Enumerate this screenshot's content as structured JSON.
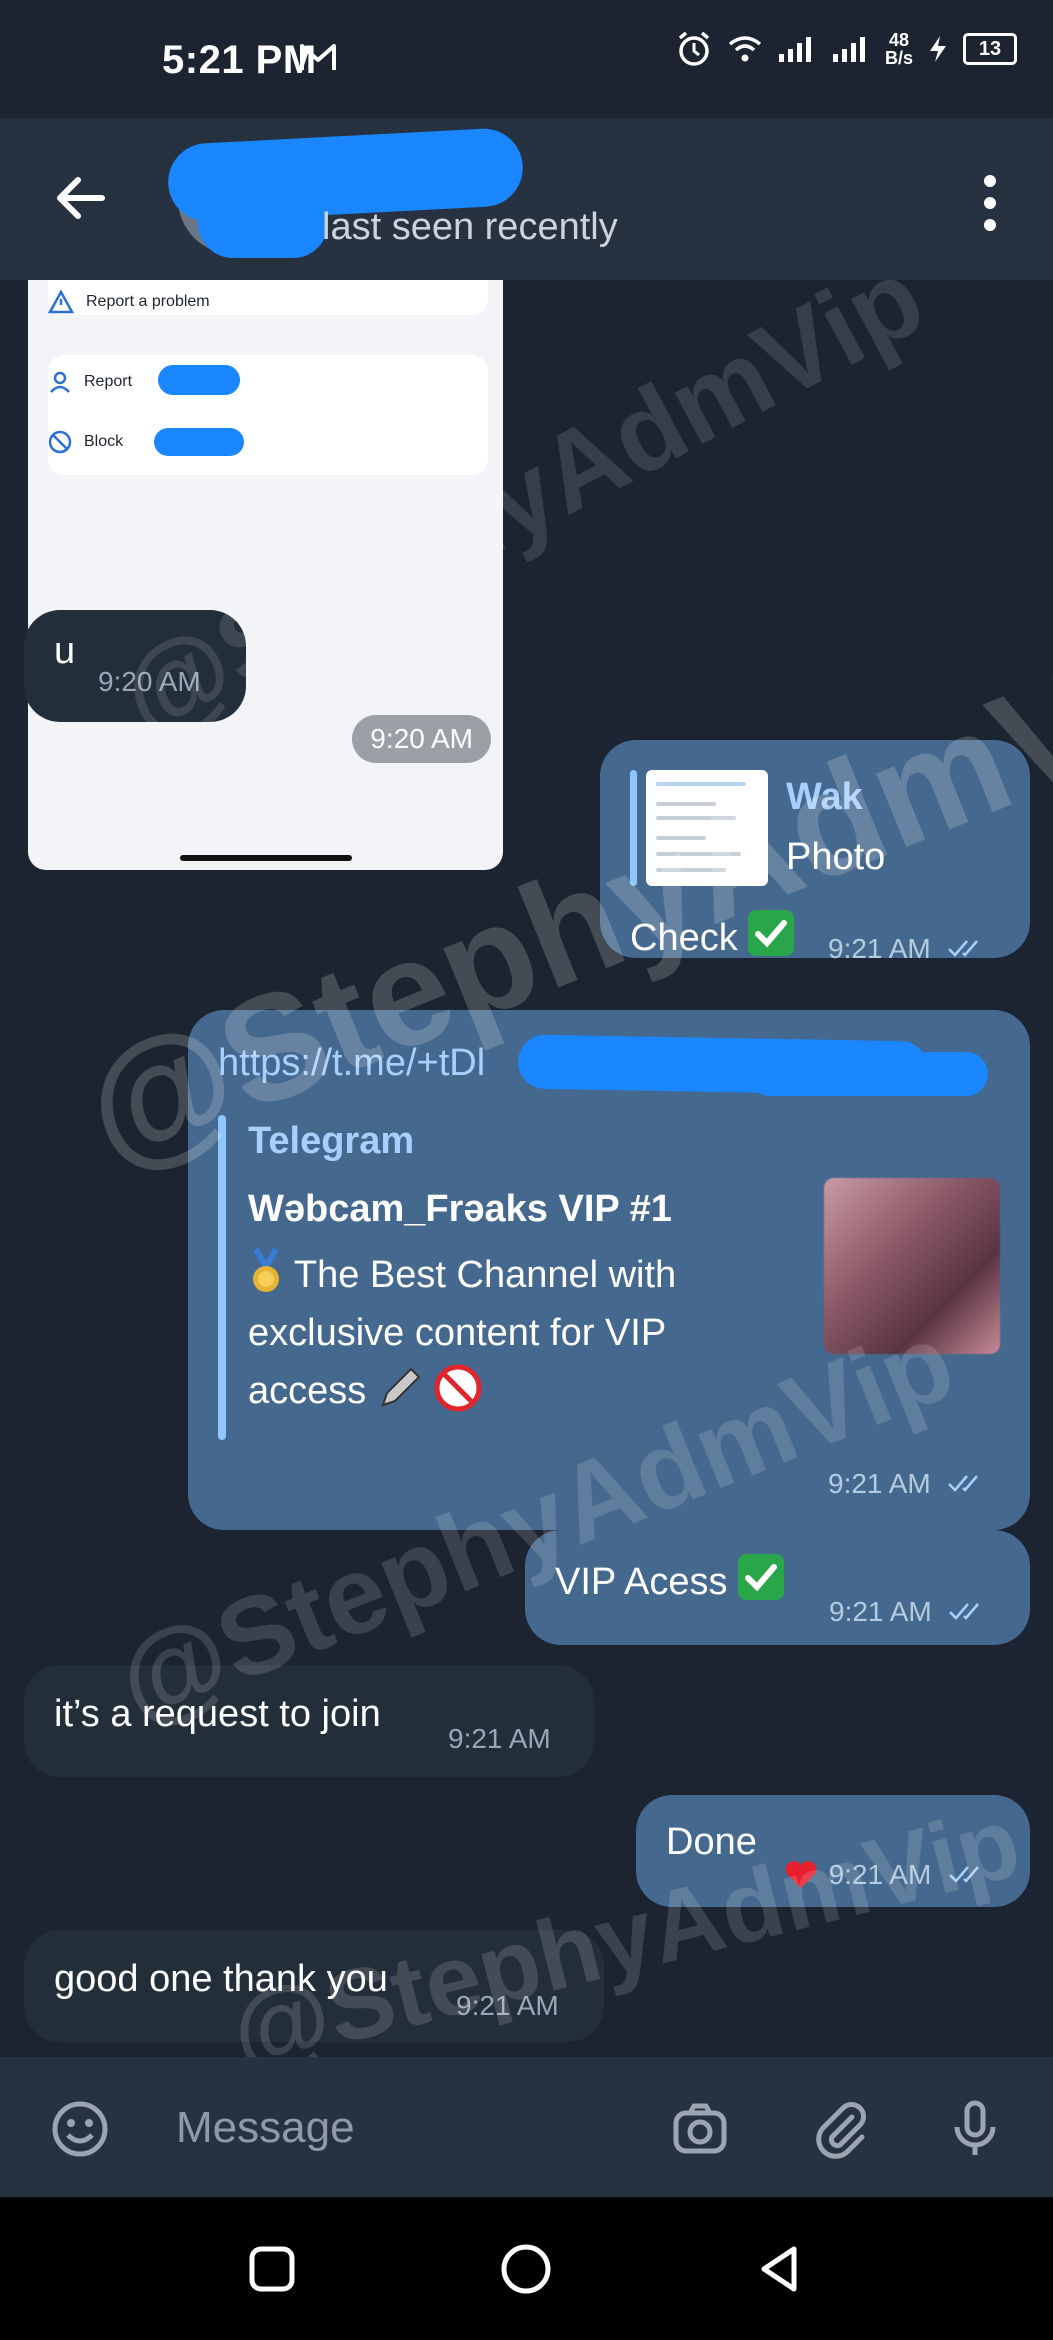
{
  "status_bar": {
    "time": "5:21 PM",
    "net_speed_value": "48",
    "net_speed_unit": "B/s",
    "battery": "13"
  },
  "header": {
    "contact_status": "last seen recently"
  },
  "screenshot_message": {
    "rows": [
      "Report a problem",
      "Report",
      "Block"
    ],
    "time": "9:20 AM"
  },
  "messages": [
    {
      "dir": "in",
      "text": "u",
      "time": "9:20 AM"
    },
    {
      "dir": "out",
      "reply_name": "Wak",
      "reply_type": "Photo",
      "text": "Check",
      "time": "9:21 AM"
    },
    {
      "dir": "out",
      "url": "https://t.me/+tDl",
      "preview_site": "Telegram",
      "preview_title": "Wəbcam_Frəaks VIP #1",
      "preview_desc": "The Best Channel with exclusive content for VIP access",
      "time": "9:21 AM"
    },
    {
      "dir": "out",
      "text": "VIP Acess",
      "time": "9:21 AM"
    },
    {
      "dir": "in",
      "text": "it’s a request to join",
      "time": "9:21 AM"
    },
    {
      "dir": "out",
      "text": "Done",
      "time": "9:21 AM"
    },
    {
      "dir": "in",
      "text": "good one thank you",
      "time": "9:21 AM"
    }
  ],
  "input": {
    "placeholder": "Message"
  },
  "watermark": "@StephyAdmVip",
  "colors": {
    "background": "#1b2430",
    "header": "#26323f",
    "incoming_bubble": "#232e3b",
    "outgoing_bubble": "#45698e",
    "link": "#a8d0ff",
    "redaction": "#1a86ff"
  }
}
